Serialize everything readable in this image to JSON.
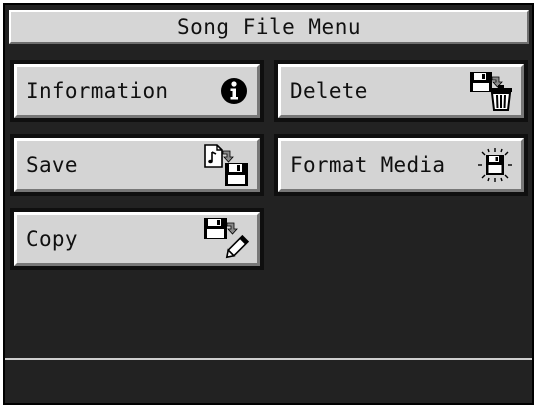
{
  "window": {
    "title": "Song File Menu"
  },
  "buttons": {
    "information": {
      "label": "Information",
      "icon": "info-icon"
    },
    "delete": {
      "label": "Delete",
      "icon": "floppy-trash-icon"
    },
    "save": {
      "label": "Save",
      "icon": "song-to-floppy-icon"
    },
    "format_media": {
      "label": "Format Media",
      "icon": "floppy-format-icon"
    },
    "copy": {
      "label": "Copy",
      "icon": "floppy-copy-icon"
    }
  },
  "colors": {
    "screen_background": "#222222",
    "button_face": "#d4d4d4",
    "title_bar": "#d6d6d6"
  }
}
